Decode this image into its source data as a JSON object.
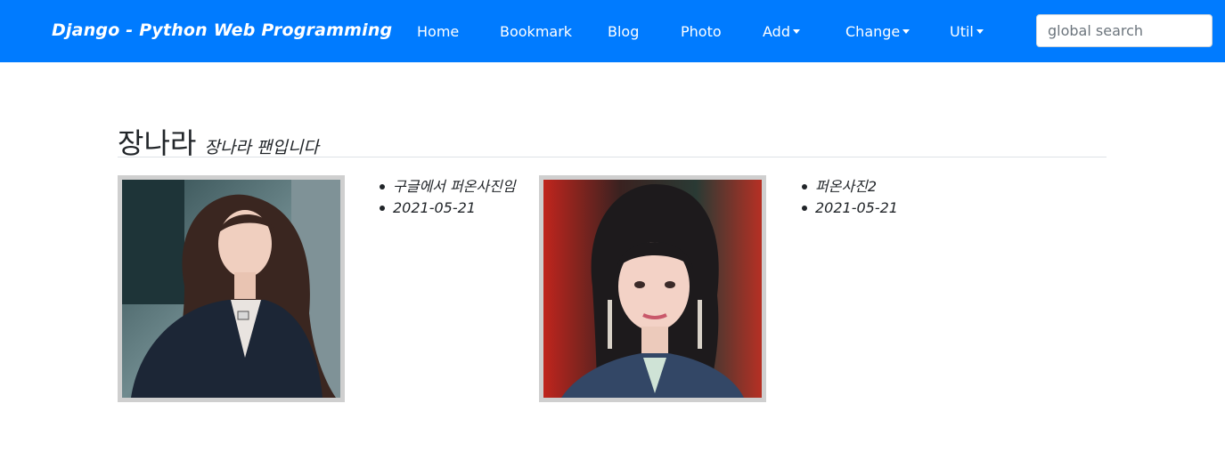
{
  "navbar": {
    "brand": "Django - Python Web Programming",
    "items": [
      {
        "label": "Home"
      },
      {
        "label": "Bookmark"
      },
      {
        "label": "Blog"
      },
      {
        "label": "Photo"
      },
      {
        "label": "Add",
        "dropdown": true
      },
      {
        "label": "Change",
        "dropdown": true
      },
      {
        "label": "Util",
        "dropdown": true
      }
    ],
    "search": {
      "placeholder": "global search",
      "value": ""
    },
    "color": "#007bff"
  },
  "album": {
    "name": "장나라",
    "description": "장나라 팬입니다"
  },
  "photos": [
    {
      "description": "구글에서 퍼온사진임",
      "date": "2021-05-21"
    },
    {
      "description": "퍼온사진2",
      "date": "2021-05-21"
    }
  ]
}
